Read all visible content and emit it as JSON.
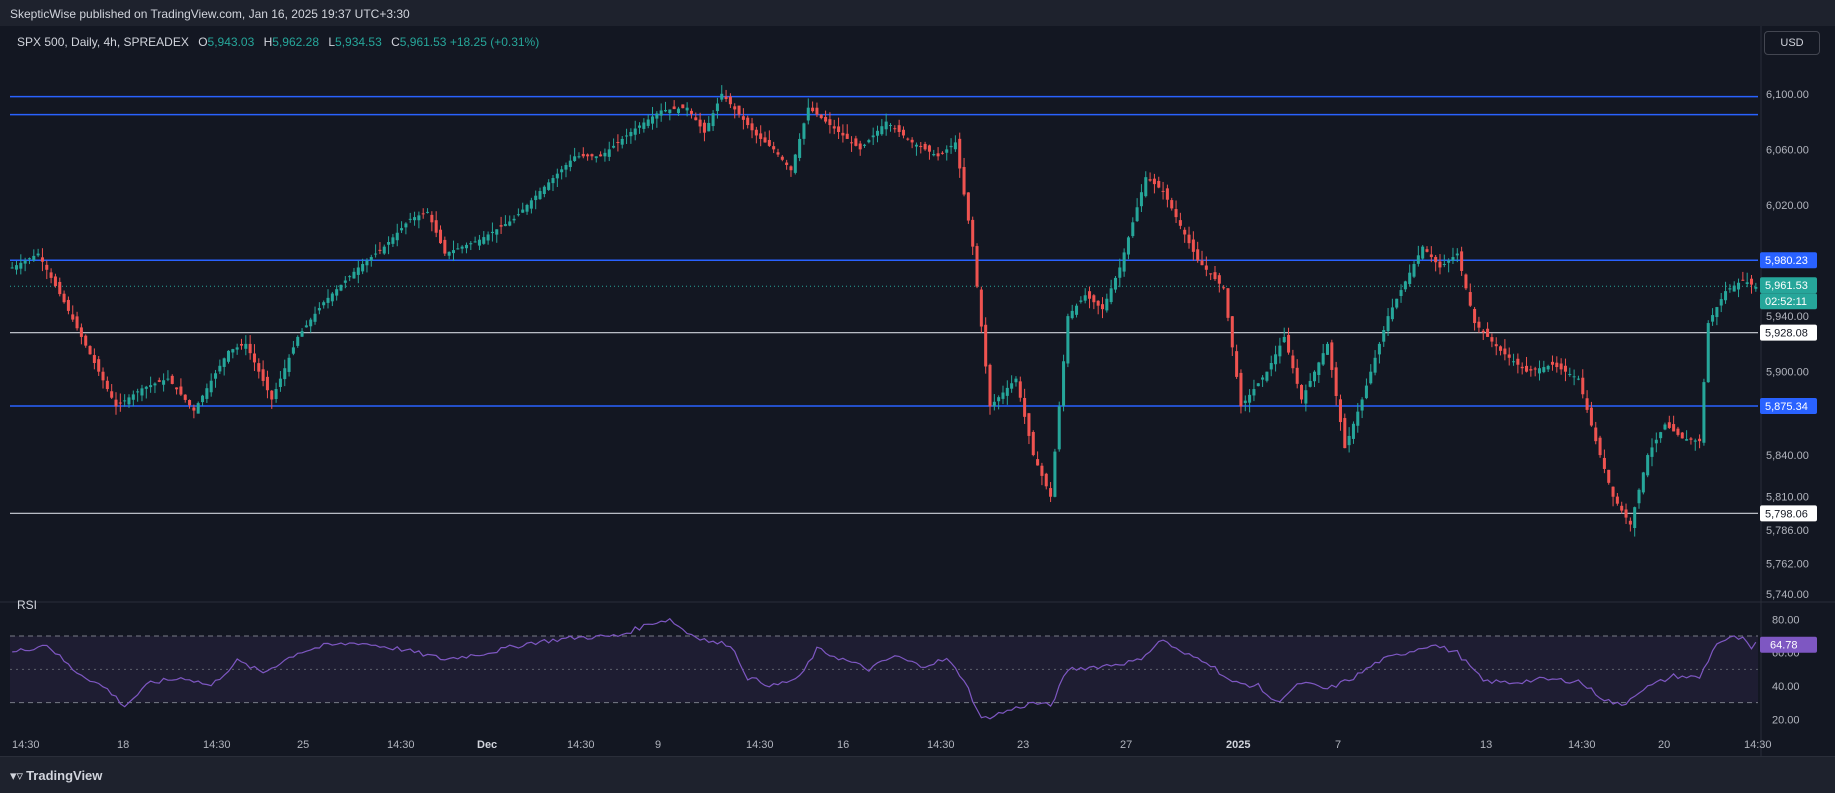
{
  "header": {
    "published": "SkepticWise published on TradingView.com, Jan 16, 2025 19:37 UTC+3:30"
  },
  "legend": {
    "symbol": "SPX 500, Daily, 4h, SPREADEX",
    "o_label": "O",
    "o_value": "5,943.03",
    "h_label": "H",
    "h_value": "5,962.28",
    "l_label": "L",
    "l_value": "5,934.53",
    "c_label": "C",
    "c_value": "5,961.53",
    "change": "+18.25 (+0.31%)"
  },
  "currency_button": "USD",
  "rsi_panel": {
    "label": "RSI",
    "value_label": "64.78"
  },
  "footer": {
    "brand": "TradingView"
  },
  "colors": {
    "background": "#131722",
    "up": "#26a69a",
    "down": "#ef5350",
    "level_blue": "#2962ff",
    "level_white": "#d1d4dc",
    "rsi": "#7e57c2"
  },
  "chart_data": [
    {
      "type": "candlestick",
      "ylim": [
        5740,
        6120
      ],
      "y_ticks": [
        "6,100.00",
        "6,060.00",
        "6,020.00",
        "5,940.00",
        "5,900.00",
        "5,840.00",
        "5,810.00",
        "5,786.00",
        "5,762.00",
        "5,740.00"
      ],
      "x_ticks": [
        "14:30",
        "18",
        "14:30",
        "25",
        "14:30",
        "Dec",
        "14:30",
        "9",
        "14:30",
        "16",
        "14:30",
        "23",
        "27",
        "2025",
        "7",
        "13",
        "14:30",
        "20",
        "14:30"
      ],
      "price_labels": [
        {
          "text": "5,980.23",
          "value": 5980.23,
          "style": "blue"
        },
        {
          "text": "5,961.53",
          "value": 5961.53,
          "style": "last"
        },
        {
          "text": "02:52:11",
          "value": 5961.53,
          "style": "countdown"
        },
        {
          "text": "5,928.08",
          "value": 5928.08,
          "style": "white"
        },
        {
          "text": "5,875.34",
          "value": 5875.34,
          "style": "blue"
        },
        {
          "text": "5,798.06",
          "value": 5798.06,
          "style": "white"
        }
      ],
      "horizontal_levels": [
        {
          "value": 6098,
          "color": "blue"
        },
        {
          "value": 6085,
          "color": "blue"
        },
        {
          "value": 5980.23,
          "color": "blue"
        },
        {
          "value": 5928.08,
          "color": "white"
        },
        {
          "value": 5875.34,
          "color": "blue"
        },
        {
          "value": 5798.06,
          "color": "white"
        }
      ],
      "last_price": 5961.53,
      "waypoints": [
        [
          0,
          5975
        ],
        [
          6,
          5985
        ],
        [
          12,
          5950
        ],
        [
          20,
          5900
        ],
        [
          24,
          5875
        ],
        [
          30,
          5888
        ],
        [
          36,
          5895
        ],
        [
          42,
          5872
        ],
        [
          50,
          5915
        ],
        [
          54,
          5920
        ],
        [
          60,
          5880
        ],
        [
          66,
          5925
        ],
        [
          72,
          5950
        ],
        [
          80,
          5975
        ],
        [
          86,
          5990
        ],
        [
          92,
          6010
        ],
        [
          96,
          6015
        ],
        [
          100,
          5985
        ],
        [
          108,
          5995
        ],
        [
          116,
          6010
        ],
        [
          122,
          6030
        ],
        [
          130,
          6055
        ],
        [
          136,
          6055
        ],
        [
          144,
          6075
        ],
        [
          150,
          6088
        ],
        [
          156,
          6090
        ],
        [
          160,
          6072
        ],
        [
          164,
          6100
        ],
        [
          168,
          6085
        ],
        [
          172,
          6070
        ],
        [
          176,
          6060
        ],
        [
          180,
          6045
        ],
        [
          184,
          6090
        ],
        [
          190,
          6075
        ],
        [
          196,
          6060
        ],
        [
          202,
          6080
        ],
        [
          208,
          6065
        ],
        [
          214,
          6055
        ],
        [
          218,
          6065
        ],
        [
          222,
          5990
        ],
        [
          226,
          5875
        ],
        [
          232,
          5895
        ],
        [
          236,
          5840
        ],
        [
          240,
          5810
        ],
        [
          244,
          5940
        ],
        [
          248,
          5955
        ],
        [
          252,
          5945
        ],
        [
          256,
          5975
        ],
        [
          262,
          6040
        ],
        [
          266,
          6030
        ],
        [
          270,
          6005
        ],
        [
          274,
          5980
        ],
        [
          280,
          5960
        ],
        [
          284,
          5875
        ],
        [
          290,
          5900
        ],
        [
          294,
          5925
        ],
        [
          298,
          5880
        ],
        [
          304,
          5920
        ],
        [
          308,
          5845
        ],
        [
          312,
          5880
        ],
        [
          318,
          5940
        ],
        [
          322,
          5965
        ],
        [
          326,
          5990
        ],
        [
          330,
          5975
        ],
        [
          334,
          5985
        ],
        [
          338,
          5935
        ],
        [
          344,
          5915
        ],
        [
          350,
          5900
        ],
        [
          356,
          5905
        ],
        [
          362,
          5895
        ],
        [
          366,
          5850
        ],
        [
          370,
          5810
        ],
        [
          374,
          5790
        ],
        [
          378,
          5840
        ],
        [
          382,
          5862
        ],
        [
          386,
          5852
        ],
        [
          390,
          5850
        ],
        [
          392,
          5935
        ],
        [
          396,
          5958
        ],
        [
          400,
          5966
        ],
        [
          403,
          5961
        ]
      ]
    },
    {
      "type": "line",
      "name": "RSI",
      "ylim": [
        10,
        85
      ],
      "y_ticks": [
        "80.00",
        "60.00",
        "40.00",
        "20.00"
      ],
      "bands": [
        70,
        30
      ],
      "midline": 50,
      "last_value": 64.78,
      "waypoints": [
        [
          0,
          60
        ],
        [
          8,
          65
        ],
        [
          14,
          50
        ],
        [
          22,
          38
        ],
        [
          26,
          28
        ],
        [
          32,
          42
        ],
        [
          40,
          45
        ],
        [
          46,
          40
        ],
        [
          52,
          55
        ],
        [
          58,
          48
        ],
        [
          66,
          60
        ],
        [
          72,
          64
        ],
        [
          80,
          66
        ],
        [
          90,
          62
        ],
        [
          100,
          56
        ],
        [
          110,
          60
        ],
        [
          120,
          66
        ],
        [
          130,
          69
        ],
        [
          140,
          70
        ],
        [
          148,
          78
        ],
        [
          152,
          80
        ],
        [
          156,
          72
        ],
        [
          162,
          66
        ],
        [
          166,
          65
        ],
        [
          170,
          45
        ],
        [
          176,
          40
        ],
        [
          182,
          45
        ],
        [
          186,
          62
        ],
        [
          192,
          56
        ],
        [
          198,
          50
        ],
        [
          204,
          58
        ],
        [
          210,
          52
        ],
        [
          216,
          56
        ],
        [
          220,
          44
        ],
        [
          224,
          20
        ],
        [
          230,
          25
        ],
        [
          236,
          30
        ],
        [
          240,
          28
        ],
        [
          244,
          50
        ],
        [
          252,
          52
        ],
        [
          260,
          55
        ],
        [
          266,
          68
        ],
        [
          270,
          60
        ],
        [
          276,
          55
        ],
        [
          282,
          42
        ],
        [
          288,
          40
        ],
        [
          292,
          30
        ],
        [
          298,
          42
        ],
        [
          304,
          38
        ],
        [
          310,
          45
        ],
        [
          316,
          55
        ],
        [
          322,
          60
        ],
        [
          328,
          65
        ],
        [
          334,
          60
        ],
        [
          340,
          43
        ],
        [
          346,
          42
        ],
        [
          354,
          44
        ],
        [
          362,
          43
        ],
        [
          368,
          32
        ],
        [
          372,
          28
        ],
        [
          376,
          37
        ],
        [
          384,
          46
        ],
        [
          390,
          45
        ],
        [
          394,
          66
        ],
        [
          398,
          69
        ],
        [
          400,
          68
        ],
        [
          402,
          62
        ],
        [
          403,
          65
        ]
      ]
    }
  ]
}
